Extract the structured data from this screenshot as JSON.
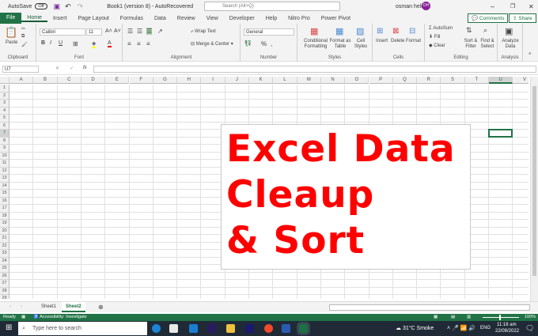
{
  "titlebar": {
    "autosave": "AutoSave",
    "toggle": "Off",
    "doc_title": "Book1 (version 8)  -  AutoRecovered",
    "search_placeholder": "Search (Alt+Q)",
    "user": "osman heli",
    "initials": "OH"
  },
  "tabs": [
    "File",
    "Home",
    "Insert",
    "Page Layout",
    "Formulas",
    "Data",
    "Review",
    "View",
    "Developer",
    "Help",
    "Nitro Pro",
    "Power Pivot"
  ],
  "comments": "Comments",
  "share": "Share",
  "ribbon": {
    "clipboard": {
      "label": "Clipboard",
      "paste": "Paste"
    },
    "font": {
      "label": "Font",
      "name": "Calibri",
      "size": "11",
      "bold": "B",
      "italic": "I",
      "underline": "U"
    },
    "alignment": {
      "label": "Alignment",
      "wrap": "Wrap Text",
      "merge": "Merge & Center"
    },
    "number": {
      "label": "Number",
      "format": "General",
      "percent": "%"
    },
    "styles": {
      "label": "Styles",
      "conditional": "Conditional Formatting",
      "format_table": "Format as Table",
      "cell_styles": "Cell Styles"
    },
    "cells": {
      "label": "Cells",
      "insert": "Insert",
      "delete": "Delete",
      "format": "Format"
    },
    "editing": {
      "label": "Editing",
      "autosum": "AutoSum",
      "fill": "Fill",
      "clear": "Clear",
      "sort": "Sort & Filter",
      "find": "Find & Select"
    },
    "analysis": {
      "label": "Analysis",
      "analyze": "Analyze Data"
    }
  },
  "formula_bar": {
    "name_box": "U7",
    "fx": "fx",
    "value": ""
  },
  "columns": [
    "A",
    "B",
    "C",
    "D",
    "E",
    "F",
    "G",
    "H",
    "I",
    "J",
    "K",
    "L",
    "M",
    "N",
    "O",
    "P",
    "Q",
    "R",
    "S",
    "T",
    "U",
    "V"
  ],
  "selected": {
    "column": "U",
    "row": 7
  },
  "overlay_lines": [
    "Excel Data",
    "Cleaup",
    "& Sort"
  ],
  "overlay_color": "#ff0000",
  "sheets": [
    "Sheet1",
    "Sheet2"
  ],
  "active_sheet": "Sheet2",
  "status": {
    "ready": "Ready",
    "accessibility": "Accessibility: Investigate",
    "zoom": "100%"
  },
  "taskbar": {
    "search_placeholder": "Type here to search",
    "weather": "31°C  Smoke",
    "lang": "ENG",
    "time": "11:18 am",
    "date": "22/09/2022"
  }
}
